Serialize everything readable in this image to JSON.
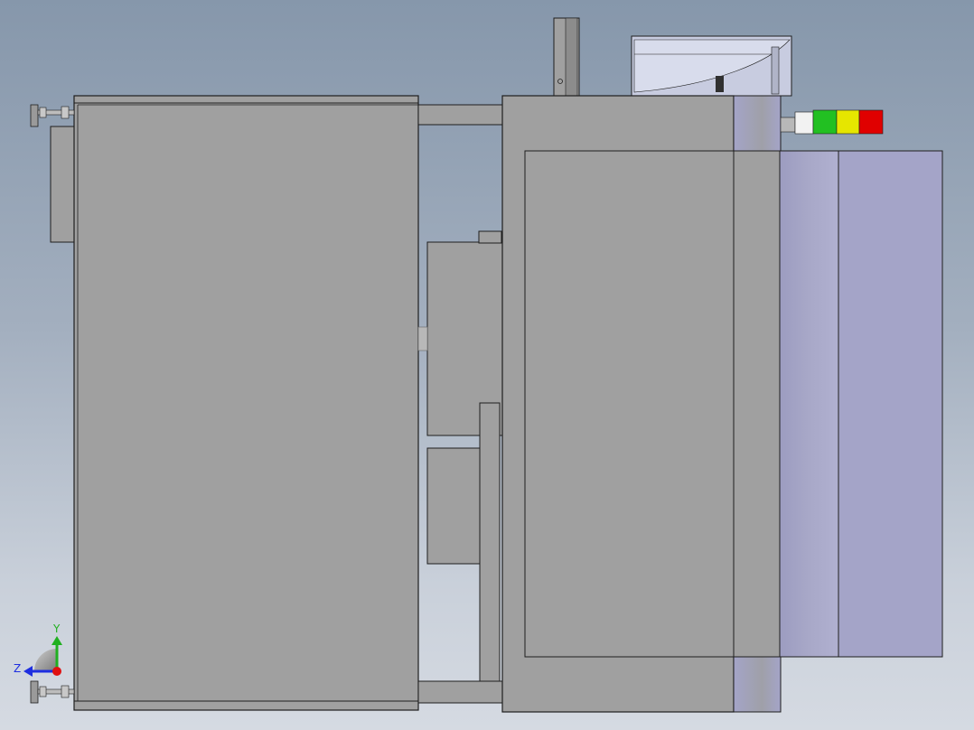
{
  "viewport": {
    "background_top": "#8697ab",
    "background_bottom": "#d5dae2"
  },
  "model": {
    "body_color": "#a0a0a0",
    "body_edge_color": "#1e1e1e",
    "panel_color": "#a4a4c8"
  },
  "tower_light": {
    "segments": [
      {
        "name": "white",
        "color": "#f2f2f2"
      },
      {
        "name": "green",
        "color": "#22c022"
      },
      {
        "name": "yellow",
        "color": "#e6e600"
      },
      {
        "name": "red",
        "color": "#e00000"
      }
    ]
  },
  "triad": {
    "y_label": "Y",
    "z_label": "Z",
    "y_color": "#20b020",
    "z_color": "#1e2ee0",
    "origin_color": "#e01010"
  }
}
